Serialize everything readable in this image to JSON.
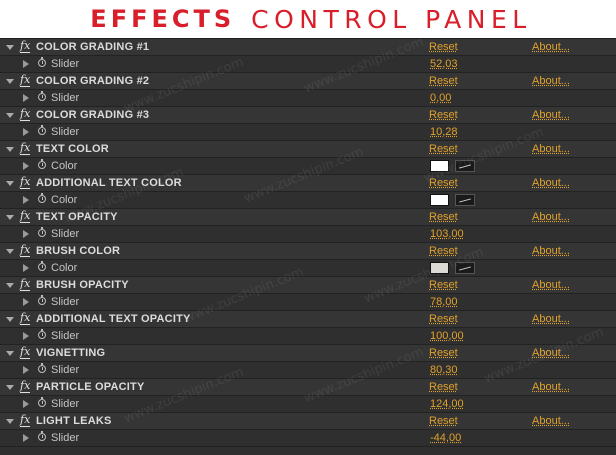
{
  "banner": {
    "title_bold": "EFFECTS",
    "title_light": "CONTROL PANEL"
  },
  "colors": {
    "accent": "#e0a22c",
    "banner_red": "#d81e2a",
    "panel_bg": "#2f2f2f"
  },
  "labels": {
    "reset": "Reset",
    "about": "About...",
    "fx": "fx"
  },
  "watermark": "www.zucshipin.com",
  "effects": [
    {
      "name": "COLOR GRADING #1",
      "param": "Slider",
      "value": "52,03"
    },
    {
      "name": "COLOR GRADING #2",
      "param": "Slider",
      "value": "0,00"
    },
    {
      "name": "COLOR GRADING #3",
      "param": "Slider",
      "value": "10,28"
    },
    {
      "name": "TEXT COLOR",
      "param": "Color",
      "color": "#ffffff"
    },
    {
      "name": "ADDITIONAL TEXT COLOR",
      "param": "Color",
      "color": "#ffffff"
    },
    {
      "name": "TEXT OPACITY",
      "param": "Slider",
      "value": "103,00"
    },
    {
      "name": "BRUSH COLOR",
      "param": "Color",
      "color": "#dcdad5"
    },
    {
      "name": "BRUSH OPACITY",
      "param": "Slider",
      "value": "78,00"
    },
    {
      "name": "ADDITIONAL TEXT  OPACITY",
      "param": "Slider",
      "value": "100,00"
    },
    {
      "name": "VIGNETTING",
      "param": "Slider",
      "value": "80,30"
    },
    {
      "name": "PARTICLE OPACITY",
      "param": "Slider",
      "value": "124,00"
    },
    {
      "name": "LIGHT LEAKS",
      "param": "Slider",
      "value": "-44,00"
    }
  ]
}
